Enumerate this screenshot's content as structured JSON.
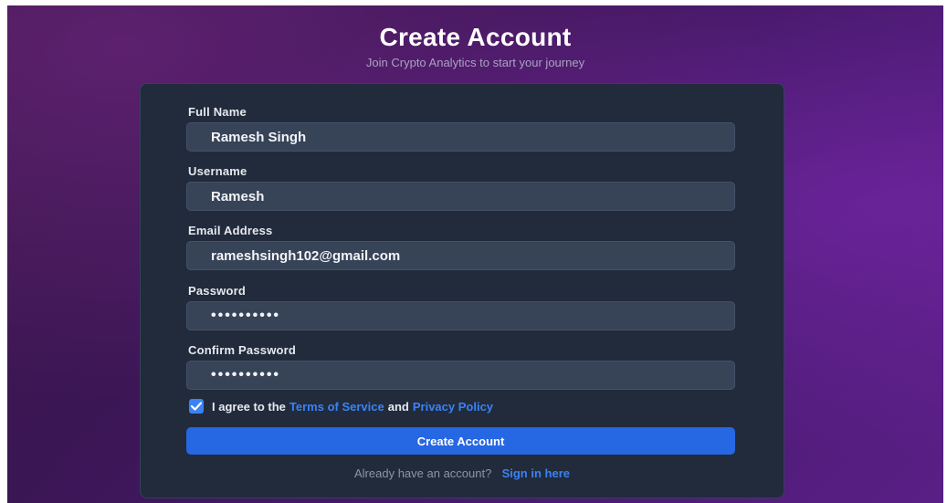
{
  "header": {
    "title": "Create Account",
    "subtitle": "Join Crypto Analytics to start your journey"
  },
  "form": {
    "full_name": {
      "label": "Full Name",
      "value": "Ramesh Singh"
    },
    "username": {
      "label": "Username",
      "value": "Ramesh"
    },
    "email": {
      "label": "Email Address",
      "value": "rameshsingh102@gmail.com"
    },
    "password": {
      "label": "Password",
      "value": "••••••••••"
    },
    "confirm_password": {
      "label": "Confirm Password",
      "value": "••••••••••"
    },
    "agree": {
      "checked": true,
      "prefix": "I agree to the",
      "terms_link": "Terms of Service",
      "and": "and",
      "privacy_link": "Privacy Policy"
    },
    "submit_label": "Create Account",
    "signin": {
      "prompt": "Already have an account?",
      "link": "Sign in here"
    }
  },
  "colors": {
    "accent": "#3b82f6",
    "button": "#2667e3",
    "card": "#212b3b",
    "input": "#374357"
  },
  "icons": {
    "checkbox": "checkmark-icon"
  }
}
